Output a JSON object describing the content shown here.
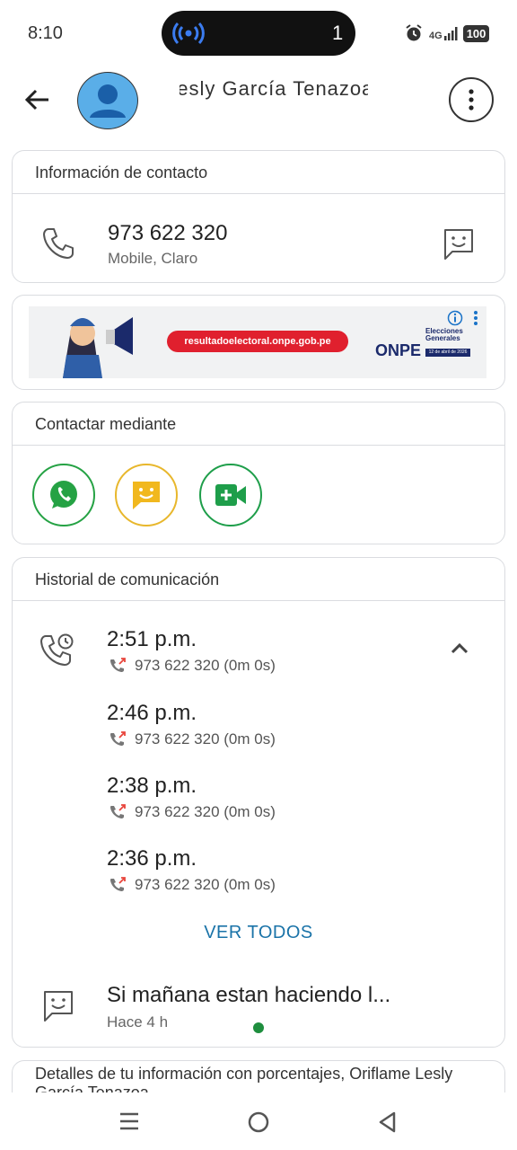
{
  "status_bar": {
    "time": "8:10",
    "active_count": "1",
    "network": "4G",
    "battery": "100"
  },
  "header": {
    "contact_name": "Lesly García Tenazoa",
    "back_icon": "arrow-left-icon",
    "more_icon": "more-vert-icon"
  },
  "contact_info": {
    "title": "Información de contacto",
    "phone": "973 622 320",
    "phone_label": "Mobile, Claro"
  },
  "ad": {
    "url": "resultadoelectoral.onpe.gob.pe",
    "brand": "ONPE",
    "subtitle": "Elecciones Generales",
    "date": "12 de abril de 2026"
  },
  "contact_via": {
    "title": "Contactar mediante",
    "colors": {
      "whatsapp": "#25a244",
      "message": "#e8b72c",
      "meet": "#1e9e4a"
    }
  },
  "history": {
    "title": "Historial de comunicación",
    "calls": [
      {
        "time": "2:51 p.m.",
        "detail": "973 622 320 (0m 0s)"
      },
      {
        "time": "2:46 p.m.",
        "detail": "973 622 320 (0m 0s)"
      },
      {
        "time": "2:38 p.m.",
        "detail": "973 622 320 (0m 0s)"
      },
      {
        "time": "2:36 p.m.",
        "detail": "973 622 320 (0m 0s)"
      }
    ],
    "see_all": "VER TODOS",
    "message": {
      "text": "Si mañana estan haciendo l...",
      "time": "Hace 4 h"
    }
  },
  "details_card": {
    "text": "Detalles de tu información con porcentajes, Oriflame Lesly García Tenazoa"
  }
}
